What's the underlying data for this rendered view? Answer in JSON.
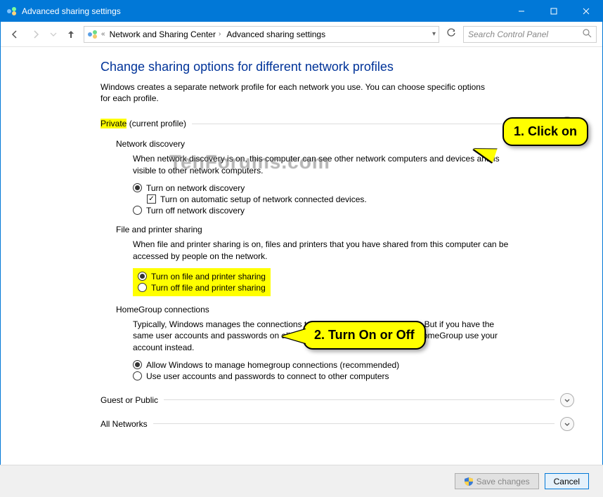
{
  "window": {
    "title": "Advanced sharing settings"
  },
  "breadcrumb": {
    "prefix": "«",
    "seg1": "Network and Sharing Center",
    "seg2": "Advanced sharing settings"
  },
  "search": {
    "placeholder": "Search Control Panel"
  },
  "page": {
    "title": "Change sharing options for different network profiles",
    "intro": "Windows creates a separate network profile for each network you use. You can choose specific options for each profile."
  },
  "profiles": {
    "private": {
      "label": "Private",
      "suffix": " (current profile)"
    },
    "guest": {
      "label": "Guest or Public"
    },
    "all": {
      "label": "All Networks"
    }
  },
  "sections": {
    "discovery": {
      "title": "Network discovery",
      "desc": "When network discovery is on, this computer can see other network computers and devices and is visible to other network computers.",
      "opt_on": "Turn on network discovery",
      "opt_on_sub": "Turn on automatic setup of network connected devices.",
      "opt_off": "Turn off network discovery"
    },
    "fileprint": {
      "title": "File and printer sharing",
      "desc": "When file and printer sharing is on, files and printers that you have shared from this computer can be accessed by people on the network.",
      "opt_on": "Turn on file and printer sharing",
      "opt_off": "Turn off file and printer sharing"
    },
    "homegroup": {
      "title": "HomeGroup connections",
      "desc": "Typically, Windows manages the connections to other homegroup computers. But if you have the same user accounts and passwords on all of your computers, you can have HomeGroup use your account instead.",
      "opt_allow": "Allow Windows to manage homegroup connections (recommended)",
      "opt_user": "Use user accounts and passwords to connect to other computers"
    }
  },
  "callouts": {
    "c1": "1. Click on",
    "c2": "2. Turn On or Off"
  },
  "watermark": "TenForums.com",
  "buttons": {
    "save": "Save changes",
    "cancel": "Cancel"
  }
}
